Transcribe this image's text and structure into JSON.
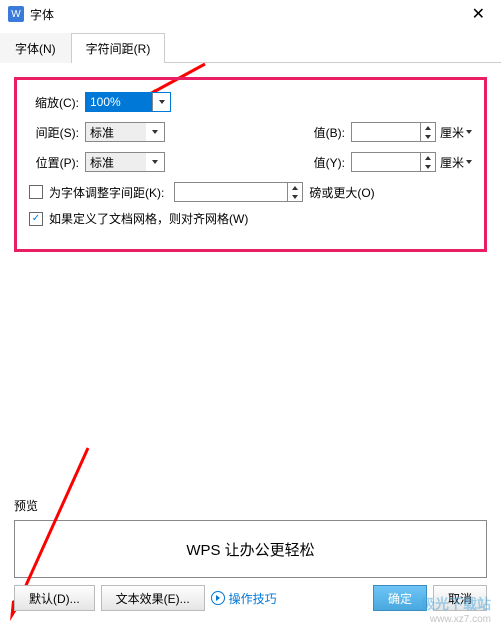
{
  "titlebar": {
    "icon_letter": "W",
    "title": "字体"
  },
  "tabs": {
    "font": "字体(N)",
    "spacing": "字符间距(R)"
  },
  "fields": {
    "scale": {
      "label": "缩放(C):",
      "value": "100%"
    },
    "spacing": {
      "label": "间距(S):",
      "value": "标准",
      "val_label": "值(B):",
      "val": "",
      "unit": "厘米"
    },
    "position": {
      "label": "位置(P):",
      "value": "标准",
      "val_label": "值(Y):",
      "val": "",
      "unit": "厘米"
    },
    "kerning": {
      "label": "为字体调整字间距(K):",
      "val": "",
      "unit": "磅或更大(O)",
      "checked": false
    },
    "snap": {
      "label": "如果定义了文档网格，则对齐网格(W)",
      "checked": true
    }
  },
  "preview": {
    "label": "预览",
    "text": "WPS 让办公更轻松"
  },
  "buttons": {
    "default": "默认(D)...",
    "effects": "文本效果(E)...",
    "tip": "操作技巧",
    "ok": "确定",
    "cancel": "取消"
  },
  "watermark": {
    "brand": "极光下载站",
    "url": "www.xz7.com"
  }
}
